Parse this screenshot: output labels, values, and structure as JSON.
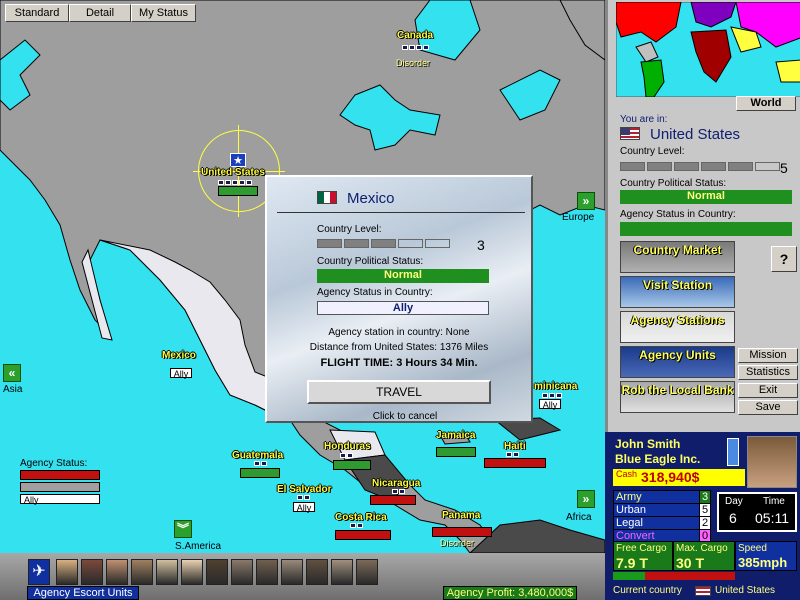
{
  "toolbar": {
    "standard": "Standard",
    "detail": "Detail",
    "my_status": "My Status"
  },
  "map": {
    "countries": [
      {
        "name": "Canada",
        "status": "Disorder"
      },
      {
        "name": "United States",
        "status": ""
      },
      {
        "name": "Mexico",
        "status": "Ally"
      },
      {
        "name": "Guatemala",
        "status": ""
      },
      {
        "name": "Honduras",
        "status": ""
      },
      {
        "name": "El Salvador",
        "status": "Ally"
      },
      {
        "name": "Nicaragua",
        "status": ""
      },
      {
        "name": "Costa Rica",
        "status": ""
      },
      {
        "name": "Panama",
        "status": "Disorder"
      },
      {
        "name": "Jamaica",
        "status": ""
      },
      {
        "name": "Haiti",
        "status": ""
      },
      {
        "name": "minicana",
        "status": "Ally"
      }
    ],
    "nav": {
      "europe": "Europe",
      "asia": "Asia",
      "africa": "Africa",
      "s_america": "S.America"
    },
    "legend": {
      "title": "Agency Status:",
      "ally": "Ally"
    }
  },
  "popup": {
    "country": "Mexico",
    "level_label": "Country Level:",
    "level_value": "3",
    "level": 3,
    "political_label": "Country Political Status:",
    "political_value": "Normal",
    "agency_label": "Agency Status in Country:",
    "agency_value": "Ally",
    "station": "Agency station in country: None",
    "distance": "Distance from United States: 1376 Miles",
    "flight": "FLIGHT TIME: 3 Hours 34 Min.",
    "travel": "TRAVEL",
    "cancel": "Click to cancel"
  },
  "side": {
    "world": "World",
    "you_are_in": "You are in:",
    "country": "United States",
    "level_label": "Country Level:",
    "level_value": "5",
    "level": 5,
    "political_label": "Country Political Status:",
    "political_value": "Normal",
    "agency_label": "Agency Status in Country:",
    "help": "?",
    "buttons": [
      "Country Market",
      "Visit Station",
      "Agency Stations",
      "Agency Units",
      "Rob the Local Bank"
    ],
    "menu": [
      "Mission",
      "Statistics",
      "Exit",
      "Save"
    ]
  },
  "status": {
    "name": "John Smith",
    "company": "Blue Eagle Inc.",
    "cash_label": "Cash",
    "cash": "318,940$",
    "army_label": "Army",
    "army": "3",
    "urban_label": "Urban",
    "urban": "5",
    "legal_label": "Legal",
    "legal": "2",
    "convert_label": "Convert",
    "convert": "0",
    "day_label": "Day",
    "day": "6",
    "time_label": "Time",
    "time": "05:11",
    "free_cargo_label": "Free Cargo",
    "free_cargo": "7.9 T",
    "max_cargo_label": "Max. Cargo",
    "max_cargo": "30 T",
    "speed_label": "Speed",
    "speed": "385mph",
    "current_country_label": "Current country",
    "current_country": "United States"
  },
  "bottom": {
    "escort": "Agency Escort Units",
    "profit": "Agency Profit: 3,480,000$"
  },
  "colors": {
    "sea": "#33e1ef",
    "land": "#9e9e9e",
    "highlight": "#e8e8ee",
    "ally": "#ffffff",
    "normal": "#1f8f1f",
    "label": "#ffff40"
  }
}
